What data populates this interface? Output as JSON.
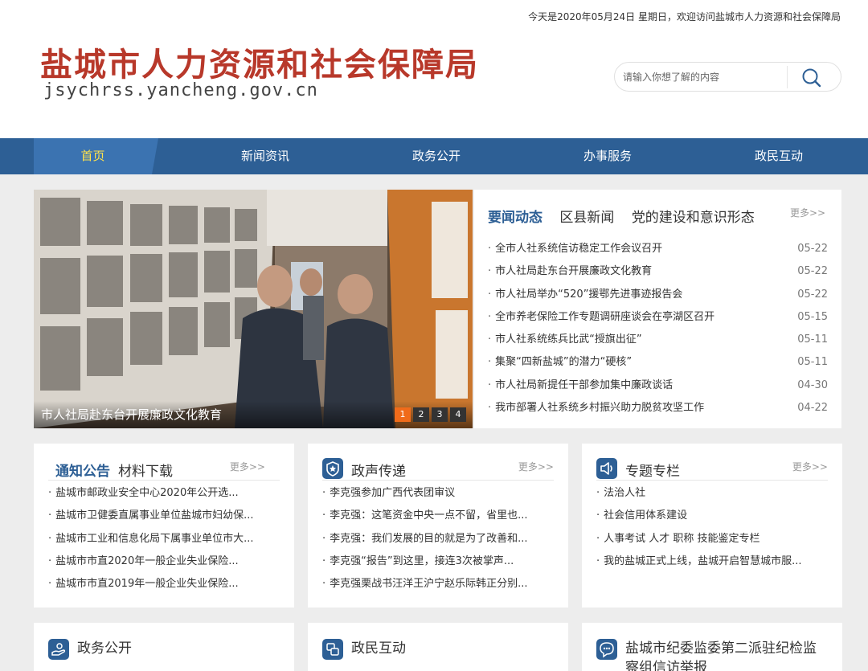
{
  "header": {
    "topline": "今天是2020年05月24日 星期日，欢迎访问盐城市人力资源和社会保障局",
    "title": "盐城市人力资源和社会保障局",
    "domain": "jsychrss.yancheng.gov.cn",
    "search_placeholder": "请输入你想了解的内容"
  },
  "nav": [
    "首页",
    "新闻资讯",
    "政务公开",
    "办事服务",
    "政民互动"
  ],
  "banner": {
    "caption": "市人社局赴东台开展廉政文化教育",
    "slides": [
      "1",
      "2",
      "3",
      "4"
    ],
    "active_slide": 0
  },
  "news": {
    "tabs": [
      "要闻动态",
      "区县新闻",
      "党的建设和意识形态"
    ],
    "more": "更多>>",
    "items": [
      {
        "title": "全市人社系统信访稳定工作会议召开",
        "date": "05-22"
      },
      {
        "title": "市人社局赴东台开展廉政文化教育",
        "date": "05-22"
      },
      {
        "title": "市人社局举办“520”援鄂先进事迹报告会",
        "date": "05-22"
      },
      {
        "title": "全市养老保险工作专题调研座谈会在亭湖区召开",
        "date": "05-15"
      },
      {
        "title": "市人社系统练兵比武“授旗出征”",
        "date": "05-11"
      },
      {
        "title": "集聚“四新盐城”的潜力“硬核”",
        "date": "05-11"
      },
      {
        "title": "市人社局新提任干部参加集中廉政谈话",
        "date": "04-30"
      },
      {
        "title": "我市部署人社系统乡村振兴助力脱贫攻坚工作",
        "date": "04-22"
      }
    ]
  },
  "cards": [
    {
      "title_main": "通知公告",
      "title_sub": "材料下载",
      "more": "更多>>",
      "items": [
        "盐城市邮政业安全中心2020年公开选...",
        "盐城市卫健委直属事业单位盐城市妇幼保...",
        "盐城市工业和信息化局下属事业单位市大...",
        "盐城市市直2020年一般企业失业保险...",
        "盐城市市直2019年一般企业失业保险..."
      ]
    },
    {
      "title": "政声传递",
      "more": "更多>>",
      "items": [
        "李克强参加广西代表团审议",
        "李克强：这笔资金中央一点不留，省里也...",
        "李克强：我们发展的目的就是为了改善和...",
        "李克强“报告”到这里，接连3次被掌声...",
        "李克强栗战书汪洋王沪宁赵乐际韩正分别..."
      ]
    },
    {
      "title": "专题专栏",
      "more": "更多>>",
      "items": [
        "法治人社",
        "社会信用体系建设",
        "人事考试 人才 职称 技能鉴定专栏",
        "我的盐城正式上线，盐城开启智慧城市服..."
      ]
    }
  ],
  "bottom_cards": [
    "政务公开",
    "政民互动",
    "盐城市纪委监委第二派驻纪检监察组信访举报"
  ]
}
